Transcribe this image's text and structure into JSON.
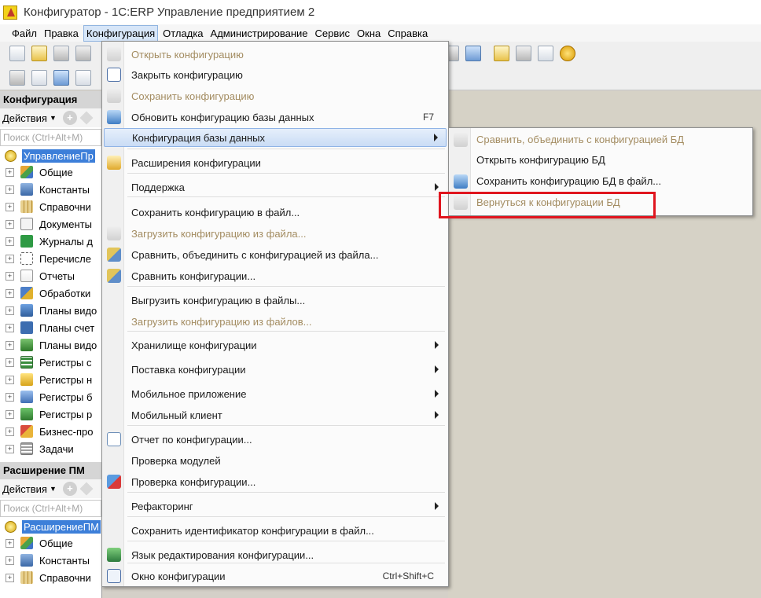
{
  "window": {
    "title": "Конфигуратор - 1С:ERP Управление предприятием 2"
  },
  "menubar": {
    "items": [
      "Файл",
      "Правка",
      "Конфигурация",
      "Отладка",
      "Администрирование",
      "Сервис",
      "Окна",
      "Справка"
    ],
    "active_index": 2
  },
  "config_panel": {
    "title": "Конфигурация",
    "actions_label": "Действия",
    "search_placeholder": "Поиск (Ctrl+Alt+M)",
    "root_label": "УправлениеПр",
    "items": [
      "Общие",
      "Константы",
      "Справочни",
      "Документы",
      "Журналы д",
      "Перечисле",
      "Отчеты",
      "Обработки",
      "Планы видо",
      "Планы счет",
      "Планы видо",
      "Регистры с",
      "Регистры н",
      "Регистры б",
      "Регистры р",
      "Бизнес-про",
      "Задачи"
    ]
  },
  "extension_panel": {
    "title": "Расширение ПМ",
    "actions_label": "Действия",
    "search_placeholder": "Поиск (Ctrl+Alt+M)",
    "root_label": "РасширениеПМ",
    "items": [
      "Общие",
      "Константы",
      "Справочни"
    ]
  },
  "config_menu": {
    "items": [
      {
        "label": "Открыть конфигурацию",
        "disabled": true
      },
      {
        "label": "Закрыть конфигурацию",
        "disabled": false
      },
      {
        "label": "Сохранить конфигурацию",
        "disabled": true
      },
      {
        "label": "Обновить конфигурацию базы данных",
        "disabled": false,
        "shortcut": "F7"
      },
      {
        "label": "Конфигурация базы данных",
        "disabled": false,
        "submenu": true,
        "highlighted": true
      },
      {
        "label": "Расширения конфигурации",
        "disabled": false
      },
      {
        "label": "Поддержка",
        "disabled": false,
        "submenu": true
      },
      {
        "label": "Сохранить конфигурацию в файл...",
        "disabled": false
      },
      {
        "label": "Загрузить конфигурацию из файла...",
        "disabled": true
      },
      {
        "label": "Сравнить, объединить с конфигурацией из файла...",
        "disabled": false
      },
      {
        "label": "Сравнить конфигурации...",
        "disabled": false
      },
      {
        "label": "Выгрузить конфигурацию в файлы...",
        "disabled": false
      },
      {
        "label": "Загрузить конфигурацию из файлов...",
        "disabled": true
      },
      {
        "label": "Хранилище конфигурации",
        "disabled": false,
        "submenu": true
      },
      {
        "label": "Поставка конфигурации",
        "disabled": false,
        "submenu": true
      },
      {
        "label": "Мобильное приложение",
        "disabled": false,
        "submenu": true
      },
      {
        "label": "Мобильный клиент",
        "disabled": false,
        "submenu": true
      },
      {
        "label": "Отчет по конфигурации...",
        "disabled": false
      },
      {
        "label": "Проверка модулей",
        "disabled": false
      },
      {
        "label": "Проверка конфигурации...",
        "disabled": false
      },
      {
        "label": "Рефакторинг",
        "disabled": false,
        "submenu": true
      },
      {
        "label": "Сохранить идентификатор конфигурации в файл...",
        "disabled": false
      },
      {
        "label": "Язык редактирования конфигурации...",
        "disabled": false
      },
      {
        "label": "Окно конфигурации",
        "disabled": false,
        "shortcut": "Ctrl+Shift+C"
      }
    ]
  },
  "db_submenu": {
    "items": [
      {
        "label": "Сравнить, объединить с конфигурацией БД",
        "disabled": true
      },
      {
        "label": "Открыть конфигурацию БД",
        "disabled": false
      },
      {
        "label": "Сохранить конфигурацию БД в файл...",
        "disabled": false
      },
      {
        "label": "Вернуться к конфигурации БД",
        "disabled": true
      }
    ],
    "highlight_color": "#e0151e"
  }
}
